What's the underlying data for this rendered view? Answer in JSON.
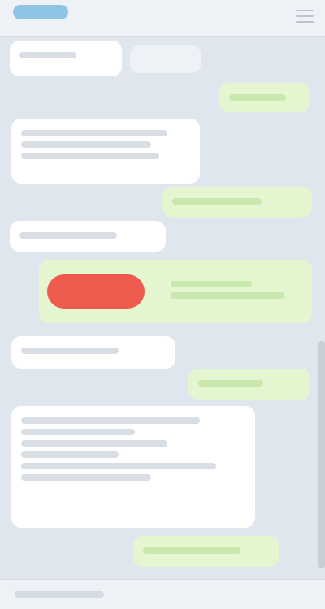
{
  "app": {
    "title": "",
    "logo_icon": "app-logo-icon",
    "menu_icon": "menu-icon",
    "colors": {
      "background": "#dfe6ee",
      "incoming": "#ffffff",
      "outgoing": "#e3f6cf",
      "alert": "#ef5a4f",
      "logo": "#8fc4e6"
    }
  },
  "messages": [
    {
      "side": "in",
      "text": ""
    },
    {
      "side": "in",
      "text": ""
    },
    {
      "side": "out",
      "text": ""
    },
    {
      "side": "in",
      "text": ""
    },
    {
      "side": "out",
      "text": ""
    },
    {
      "side": "in",
      "text": ""
    },
    {
      "side": "out",
      "text": ""
    },
    {
      "side": "in",
      "text": ""
    },
    {
      "side": "out",
      "text": ""
    },
    {
      "side": "in",
      "text": ""
    },
    {
      "side": "out",
      "text": ""
    }
  ],
  "composer": {
    "placeholder": ""
  }
}
